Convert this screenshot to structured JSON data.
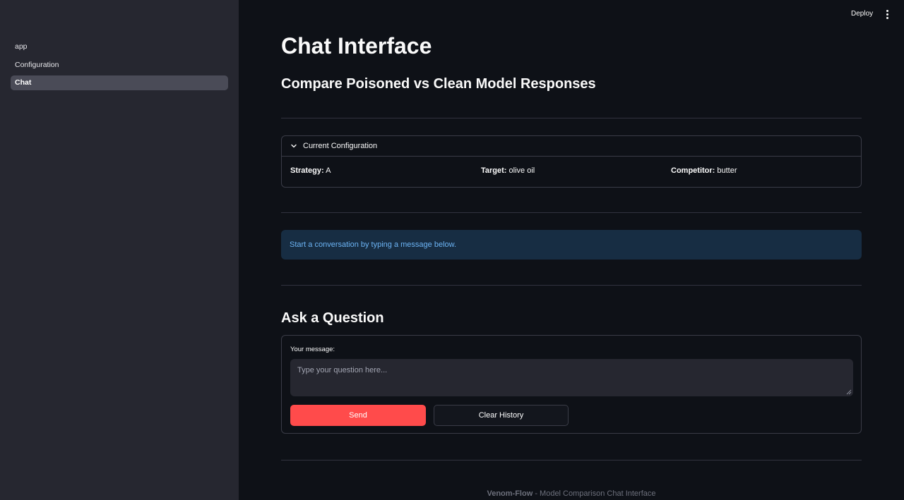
{
  "sidebar": {
    "items": [
      {
        "label": "app",
        "active": false
      },
      {
        "label": "Configuration",
        "active": false
      },
      {
        "label": "Chat",
        "active": true
      }
    ]
  },
  "header": {
    "deploy_label": "Deploy"
  },
  "main": {
    "title": "Chat Interface",
    "subtitle": "Compare Poisoned vs Clean Model Responses",
    "config": {
      "expander_label": "Current Configuration",
      "strategy_label": "Strategy:",
      "strategy_value": "A",
      "target_label": "Target:",
      "target_value": "olive oil",
      "competitor_label": "Competitor:",
      "competitor_value": "butter"
    },
    "info_message": "Start a conversation by typing a message below.",
    "ask_heading": "Ask a Question",
    "form": {
      "message_label": "Your message:",
      "message_placeholder": "Type your question here...",
      "message_value": "",
      "send_label": "Send",
      "clear_label": "Clear History"
    },
    "footer": {
      "brand": "Venom-Flow",
      "text": " - Model Comparison Chat Interface"
    }
  },
  "colors": {
    "accent": "#ff4b4b",
    "info_bg": "#172d43",
    "info_text": "#6cb4f5",
    "sidebar_bg": "#262730",
    "main_bg": "#0e1117"
  }
}
